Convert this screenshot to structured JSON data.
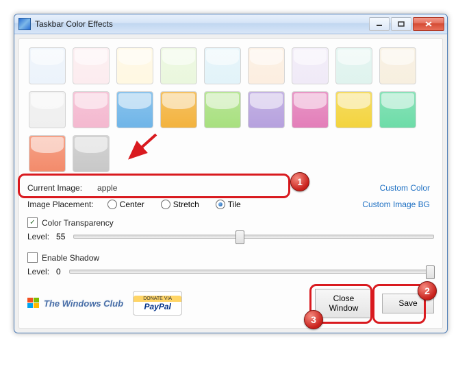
{
  "window": {
    "title": "Taskbar Color Effects"
  },
  "swatches": [
    "#ecf3fb",
    "#fcecef",
    "#fff8e2",
    "#eaf7dd",
    "#e2f3f9",
    "#fceee0",
    "#f0eaf7",
    "#dff3ee",
    "#f7efdf",
    "#efefef",
    "#f4b8cf",
    "#6fb5e8",
    "#f3b33e",
    "#a8e07f",
    "#b6a1de",
    "#e37eb9",
    "#f3d43e",
    "#6ddca8",
    "#f38b6b",
    "#c8c8c8"
  ],
  "current_image": {
    "label": "Current Image:",
    "value": "apple"
  },
  "custom_color_link": "Custom Color",
  "custom_image_link": "Custom Image BG",
  "placement": {
    "label": "Image Placement:",
    "options": {
      "center": "Center",
      "stretch": "Stretch",
      "tile": "Tile"
    },
    "selected": "tile"
  },
  "transparency": {
    "label": "Color Transparency",
    "checked": true,
    "level_label": "Level:",
    "level": "55",
    "slider_pos_pct": 45
  },
  "shadow": {
    "label": "Enable Shadow",
    "checked": false,
    "level_label": "Level:",
    "level": "0",
    "slider_pos_pct": 98
  },
  "footer": {
    "windows_club": "The Windows Club",
    "paypal_top": "DONATE VIA",
    "paypal_mid": "PayPal"
  },
  "buttons": {
    "close": "Close\nWindow",
    "save": "Save"
  },
  "annotations": {
    "b1": "1",
    "b2": "2",
    "b3": "3"
  }
}
